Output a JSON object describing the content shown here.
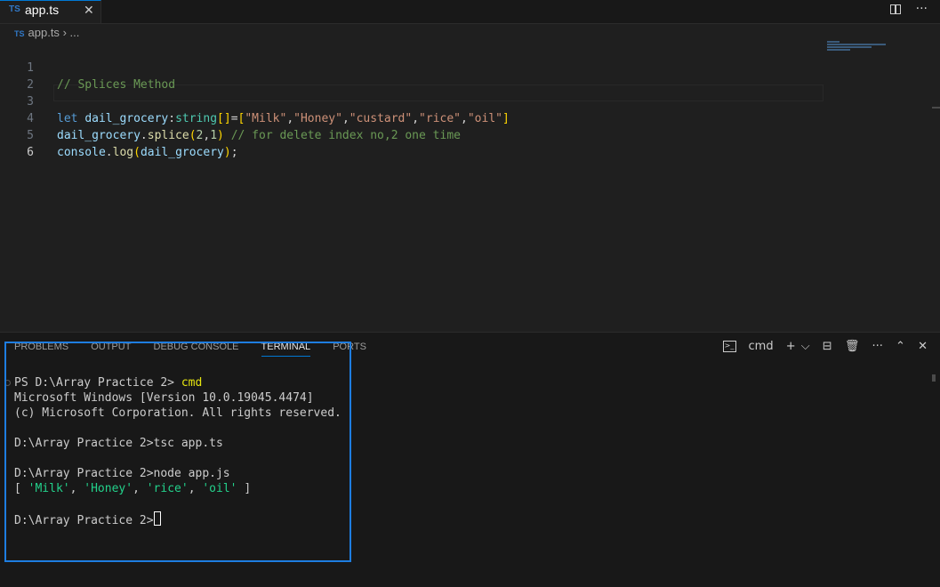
{
  "tab": {
    "badge": "TS",
    "label": "app.ts",
    "close": "✕"
  },
  "top_actions": {
    "more": "···"
  },
  "breadcrumb": {
    "badge": "TS",
    "file": "app.ts",
    "sep": "›",
    "rest": "..."
  },
  "editor": {
    "lines": [
      {
        "num": "1",
        "text": "// Splices Method"
      },
      {
        "num": "2",
        "text": ""
      },
      {
        "num": "3",
        "text": "let dail_grocery:string[]=[\"Milk\",\"Honey\",\"custard\",\"rice\",\"oil\"]"
      },
      {
        "num": "4",
        "text": "dail_grocery.splice(2,1) // for delete index no,2 one time"
      },
      {
        "num": "5",
        "text": "console.log(dail_grocery);"
      },
      {
        "num": "6",
        "text": ""
      }
    ]
  },
  "panel": {
    "tabs": [
      "PROBLEMS",
      "OUTPUT",
      "DEBUG CONSOLE",
      "TERMINAL",
      "PORTS"
    ],
    "active_tab": "TERMINAL",
    "terminal_name": "cmd",
    "actions": {
      "add": "+",
      "dropdown": "⌵",
      "split": "⊟",
      "trash": "🗑",
      "more": "···",
      "maximize": "⌃",
      "close": "✕"
    }
  },
  "terminal": {
    "lines": [
      {
        "prompt": "PS D:\\Array Practice 2> ",
        "cmd": "cmd"
      },
      {
        "text": "Microsoft Windows [Version 10.0.19045.4474]"
      },
      {
        "text": "(c) Microsoft Corporation. All rights reserved."
      },
      {
        "text": ""
      },
      {
        "text": "D:\\Array Practice 2>tsc app.ts"
      },
      {
        "text": ""
      },
      {
        "text": "D:\\Array Practice 2>node app.js"
      },
      {
        "output": "[ 'Milk', 'Honey', 'rice', 'oil' ]"
      },
      {
        "text": ""
      },
      {
        "prompt_end": "D:\\Array Practice 2>"
      }
    ]
  },
  "colors": {
    "accent": "#0078d4",
    "highlight_box": "#1e7de0",
    "background": "#1f1f1f"
  }
}
